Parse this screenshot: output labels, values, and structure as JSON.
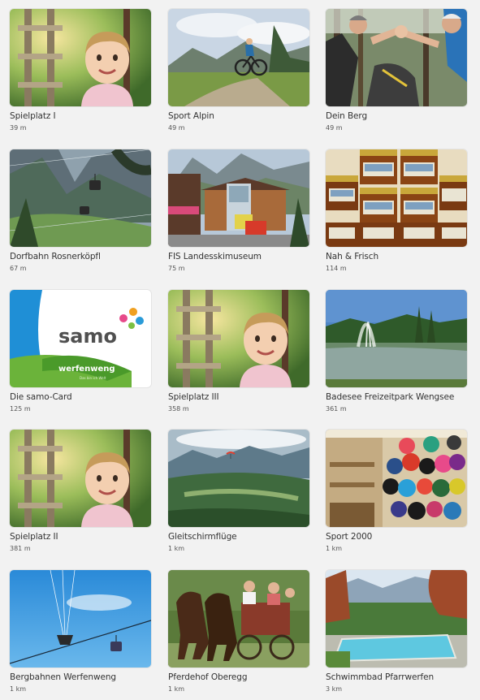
{
  "cards": [
    {
      "title": "Spielplatz I",
      "distance": "39 m",
      "image": "playground-child-photo"
    },
    {
      "title": "Sport Alpin",
      "distance": "49 m",
      "image": "mountain-biker-photo"
    },
    {
      "title": "Dein Berg",
      "distance": "49 m",
      "image": "climbers-high-five-photo"
    },
    {
      "title": "Dorfbahn Rosnerköpfl",
      "distance": "67 m",
      "image": "cable-car-valley-photo"
    },
    {
      "title": "FIS Landesskimuseum",
      "distance": "75 m",
      "image": "ski-museum-building-photo"
    },
    {
      "title": "Nah & Frisch",
      "distance": "114 m",
      "image": "honey-jars-photo"
    },
    {
      "title": "Die samo-Card",
      "distance": "125 m",
      "image": "samo-card-logo",
      "logo_text": "samo",
      "logo_sub": "werfenweng",
      "logo_tagline": "Das bin ich Welt"
    },
    {
      "title": "Spielplatz III",
      "distance": "358 m",
      "image": "playground-child-photo"
    },
    {
      "title": "Badesee Freizeitpark Wengsee",
      "distance": "361 m",
      "image": "lake-fountain-photo"
    },
    {
      "title": "Spielplatz II",
      "distance": "381 m",
      "image": "playground-child-photo"
    },
    {
      "title": "Gleitschirmflüge",
      "distance": "1 km",
      "image": "paraglider-valley-photo"
    },
    {
      "title": "Sport 2000",
      "distance": "1 km",
      "image": "ski-shop-helmets-photo"
    },
    {
      "title": "Bergbahnen Werfenweng",
      "distance": "1 km",
      "image": "gondola-blue-sky-photo"
    },
    {
      "title": "Pferdehof Oberegg",
      "distance": "1 km",
      "image": "horse-carriage-photo"
    },
    {
      "title": "Schwimmbad Pfarrwerfen",
      "distance": "3 km",
      "image": "outdoor-pool-photo"
    }
  ]
}
